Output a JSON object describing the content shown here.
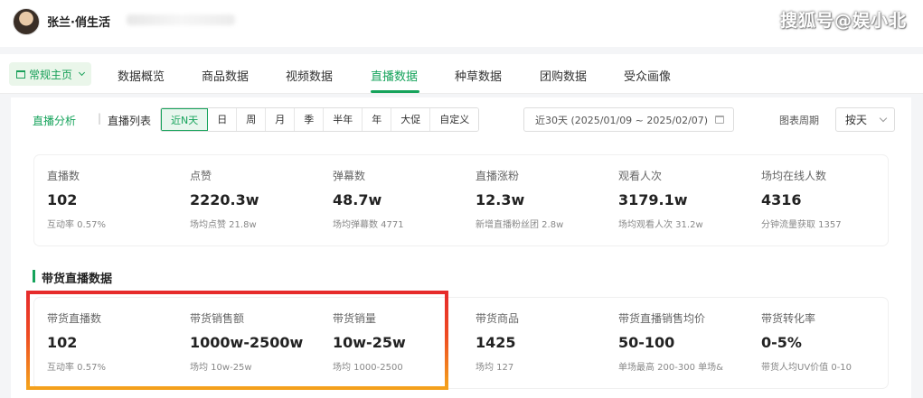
{
  "header": {
    "account_name": "张兰·俏生活",
    "watermark": "搜狐号@娱小北"
  },
  "nav": {
    "home_label": "常规主页",
    "items": [
      "数据概览",
      "商品数据",
      "视频数据",
      "直播数据",
      "种草数据",
      "团购数据",
      "受众画像"
    ],
    "active_item": "直播数据"
  },
  "subtabs": {
    "analysis": "直播分析",
    "separator": "|",
    "list": "直播列表"
  },
  "range_buttons": [
    "近N天",
    "日",
    "周",
    "月",
    "季",
    "半年",
    "年",
    "大促",
    "自定义"
  ],
  "active_range": "近N天",
  "date_range": "近30天 (2025/01/09 ~ 2025/02/07)",
  "period": {
    "label": "图表周期",
    "value": "按天"
  },
  "overview_metrics": [
    {
      "label": "直播数",
      "value": "102",
      "sub": "互动率 0.57%"
    },
    {
      "label": "点赞",
      "value": "2220.3w",
      "sub": "场均点赞 21.8w"
    },
    {
      "label": "弹幕数",
      "value": "48.7w",
      "sub": "场均弹幕数 4771"
    },
    {
      "label": "直播涨粉",
      "value": "12.3w",
      "sub": "新增直播粉丝团 2.8w"
    },
    {
      "label": "观看人次",
      "value": "3179.1w",
      "sub": "场均观看人次 31.2w"
    },
    {
      "label": "场均在线人数",
      "value": "4316",
      "sub": "分钟流量获取 1357"
    }
  ],
  "section_title": "带货直播数据",
  "sales_metrics": [
    {
      "label": "带货直播数",
      "value": "102",
      "sub": "互动率 0.57%"
    },
    {
      "label": "带货销售额",
      "value": "1000w-2500w",
      "sub": "场均 10w-25w"
    },
    {
      "label": "带货销量",
      "value": "10w-25w",
      "sub": "场均 1000-2500"
    },
    {
      "label": "带货商品",
      "value": "1425",
      "sub": "场均 127"
    },
    {
      "label": "带货直播销售均价",
      "value": "50-100",
      "sub": "单场最高 200-300 单场&"
    },
    {
      "label": "带货转化率",
      "value": "0-5%",
      "sub": "带货人均UV价值 0-10"
    }
  ],
  "colors": {
    "accent": "#16a35b",
    "highlight_top": "#e62b2b",
    "highlight_bottom": "#f4a11c"
  }
}
